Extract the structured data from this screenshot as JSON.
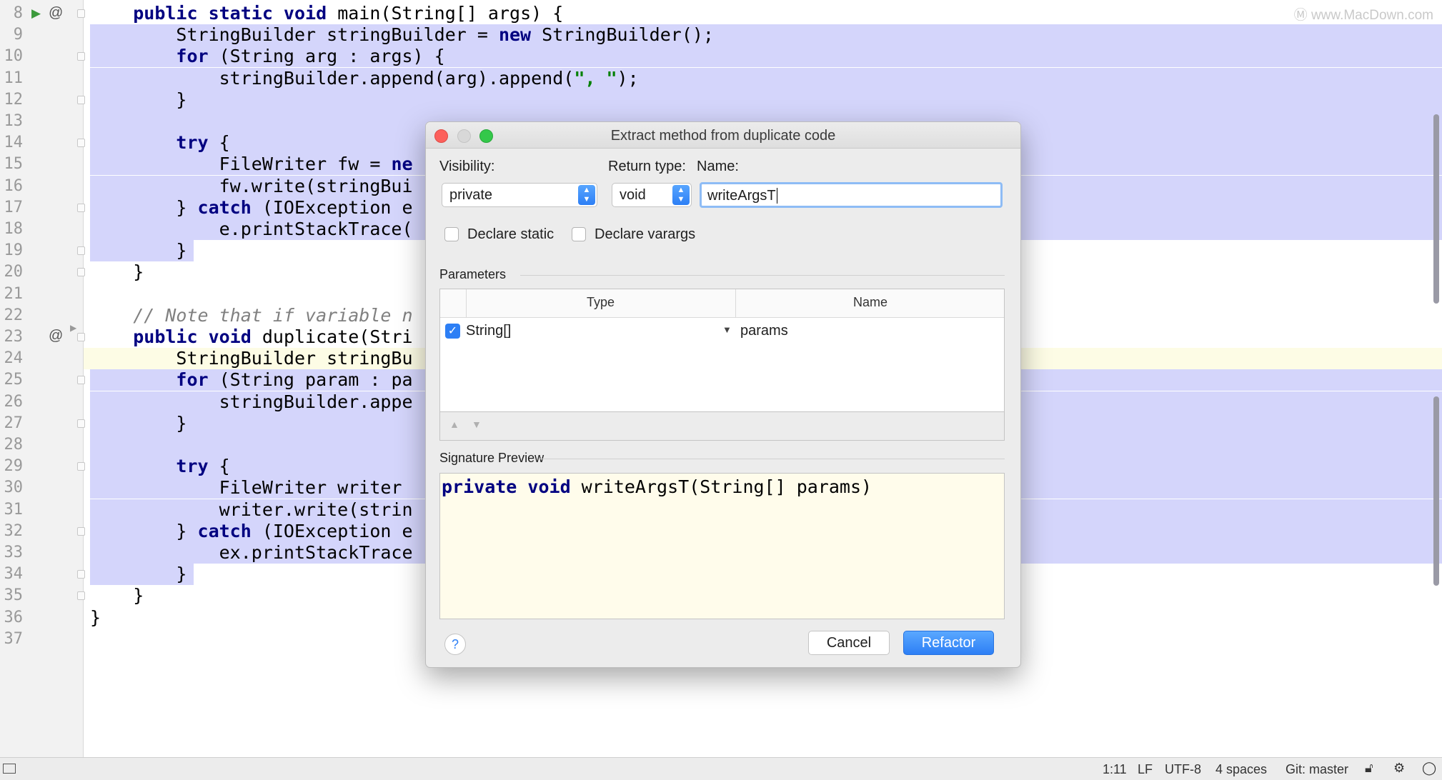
{
  "editor": {
    "lines": [
      {
        "num": "8",
        "code": "    <span class=\"kw\">public static void</span> main(String[] args) {"
      },
      {
        "num": "9",
        "code": "        StringBuilder stringBuilder = <span class=\"kw\">new</span> StringBuilder();"
      },
      {
        "num": "10",
        "code": "        <span class=\"kw\">for</span> (String arg : args) {"
      },
      {
        "num": "11",
        "code": "            stringBuilder.append(arg).append(<span class=\"str\">\", \"</span>);"
      },
      {
        "num": "12",
        "code": "        }"
      },
      {
        "num": "13",
        "code": ""
      },
      {
        "num": "14",
        "code": "        <span class=\"kw\">try</span> {"
      },
      {
        "num": "15",
        "code": "            FileWriter fw = <span class=\"kw\">ne</span>"
      },
      {
        "num": "16",
        "code": "            fw.write(stringBui"
      },
      {
        "num": "17",
        "code": "        } <span class=\"kw\">catch</span> (IOException e"
      },
      {
        "num": "18",
        "code": "            e.printStackTrace("
      },
      {
        "num": "19",
        "code": "        }"
      },
      {
        "num": "20",
        "code": "    }"
      },
      {
        "num": "21",
        "code": ""
      },
      {
        "num": "22",
        "code": "    <span class=\"cmt\">// Note that if variable n</span>"
      },
      {
        "num": "23",
        "code": "    <span class=\"kw\">public void</span> duplicate(Stri"
      },
      {
        "num": "24",
        "code": "        StringBuilder stringBu"
      },
      {
        "num": "25",
        "code": "        <span class=\"kw\">for</span> (String param : pa"
      },
      {
        "num": "26",
        "code": "            stringBuilder.appe"
      },
      {
        "num": "27",
        "code": "        }"
      },
      {
        "num": "28",
        "code": ""
      },
      {
        "num": "29",
        "code": "        <span class=\"kw\">try</span> {"
      },
      {
        "num": "30",
        "code": "            FileWriter writer"
      },
      {
        "num": "31",
        "code": "            writer.write(strin"
      },
      {
        "num": "32",
        "code": "        } <span class=\"kw\">catch</span> (IOException e"
      },
      {
        "num": "33",
        "code": "            ex.printStackTrace"
      },
      {
        "num": "34",
        "code": "        }"
      },
      {
        "num": "35",
        "code": "    }"
      },
      {
        "num": "36",
        "code": "}"
      },
      {
        "num": "37",
        "code": ""
      }
    ],
    "watermark": "www.MacDown.com"
  },
  "dialog": {
    "title": "Extract method from duplicate code",
    "visibility_label": "Visibility:",
    "visibility_value": "private",
    "return_type_label": "Return type:",
    "return_type_value": "void",
    "name_label": "Name:",
    "name_value": "writeArgsT",
    "declare_static_label": "Declare static",
    "declare_varargs_label": "Declare varargs",
    "parameters_label": "Parameters",
    "params_header_type": "Type",
    "params_header_name": "Name",
    "params_rows": [
      {
        "type": "String[]",
        "name": "params"
      }
    ],
    "signature_label": "Signature Preview",
    "signature_text": "<span class=\"kw\">private void</span> writeArgsT(String[] params)",
    "help_label": "?",
    "cancel_label": "Cancel",
    "refactor_label": "Refactor"
  },
  "statusbar": {
    "position": "1:11",
    "line_sep": "LF",
    "encoding": "UTF-8",
    "indent": "4 spaces",
    "vcs": "Git: master"
  },
  "colors": {
    "selection": "#d4d5fb",
    "keyword": "#000080",
    "string": "#008000",
    "accent": "#2d7ff5",
    "signature_bg": "#fffceb"
  }
}
